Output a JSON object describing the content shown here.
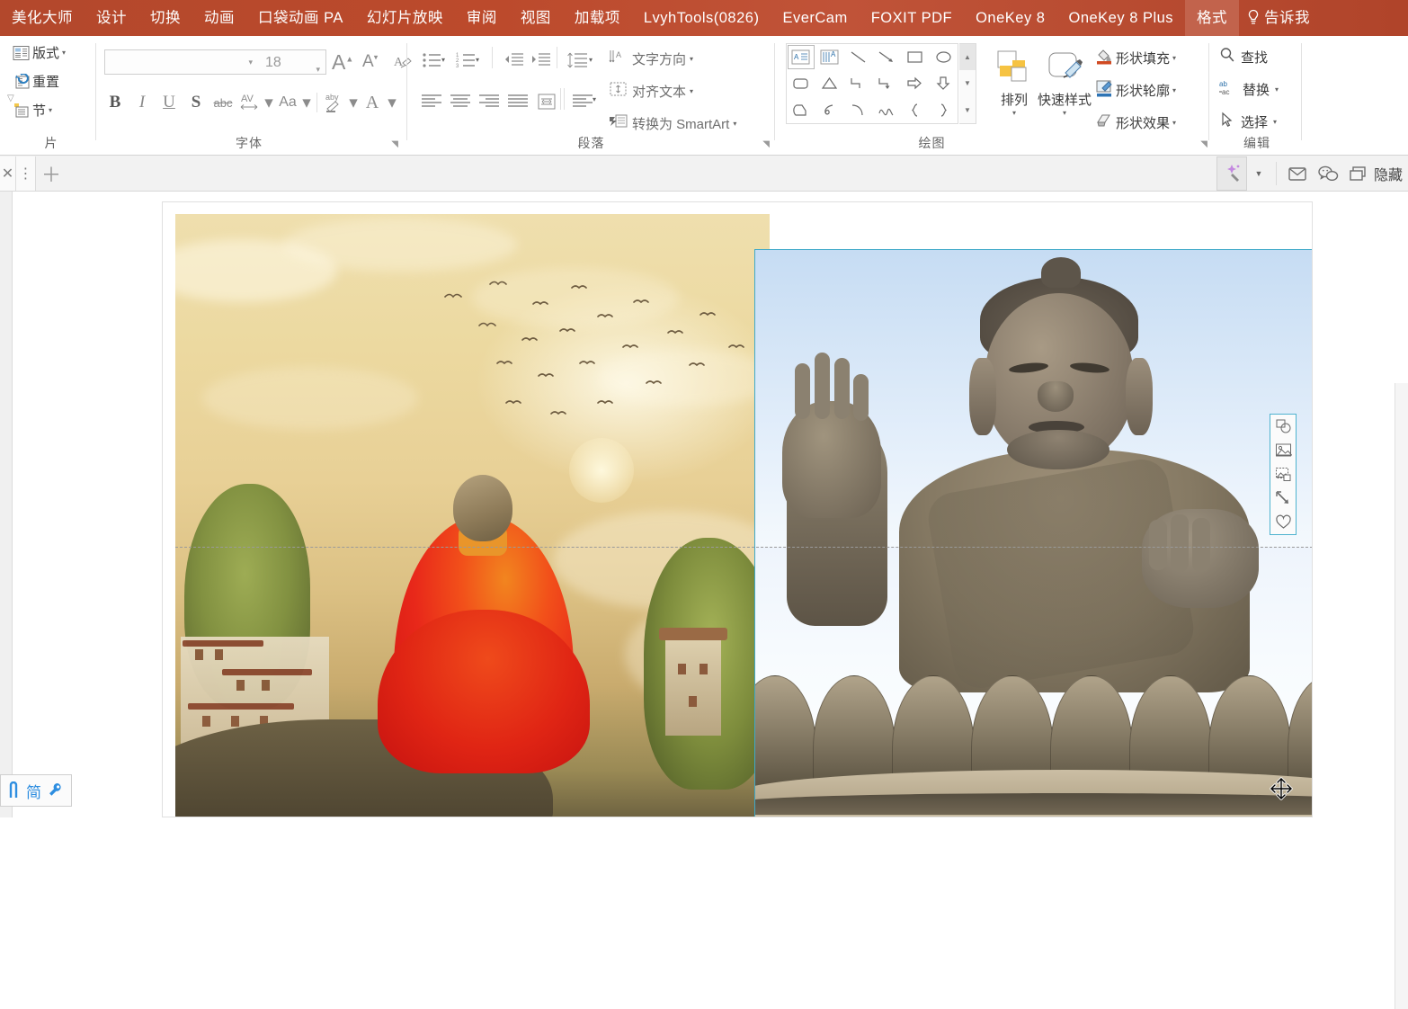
{
  "window": {
    "app": "PowerPoint",
    "accent_color": "#b7472a",
    "selection_color": "#3fa9c9"
  },
  "tabs": [
    {
      "label": "美化大师",
      "active": false
    },
    {
      "label": "设计",
      "active": false
    },
    {
      "label": "切换",
      "active": false
    },
    {
      "label": "动画",
      "active": false
    },
    {
      "label": "口袋动画 PA",
      "active": false
    },
    {
      "label": "幻灯片放映",
      "active": false
    },
    {
      "label": "审阅",
      "active": false
    },
    {
      "label": "视图",
      "active": false
    },
    {
      "label": "加载项",
      "active": false
    },
    {
      "label": "LvyhTools(0826)",
      "active": false
    },
    {
      "label": "EverCam",
      "active": false
    },
    {
      "label": "FOXIT PDF",
      "active": false
    },
    {
      "label": "OneKey 8",
      "active": false
    },
    {
      "label": "OneKey 8 Plus",
      "active": false
    },
    {
      "label": "格式",
      "active": true
    }
  ],
  "tell_me": {
    "label": "告诉我",
    "icon": "lightbulb-icon"
  },
  "ribbon": {
    "slides_group": {
      "label": "片",
      "buttons": [
        {
          "label": "版式",
          "icon": "layout-icon",
          "has_caret": true
        },
        {
          "label": "重置",
          "icon": "reset-icon",
          "has_caret": false
        },
        {
          "label": "节",
          "icon": "section-icon",
          "has_caret": true
        }
      ]
    },
    "font_group": {
      "label": "字体",
      "font_name": {
        "value": "",
        "placeholder": ""
      },
      "font_size": {
        "value": "18"
      },
      "grow_font": "A",
      "shrink_font": "A",
      "clear_format_icon": "clear-formatting-icon",
      "buttons": [
        {
          "label": "B",
          "name": "bold"
        },
        {
          "label": "I",
          "name": "italic"
        },
        {
          "label": "U",
          "name": "underline"
        },
        {
          "label": "S",
          "name": "shadow"
        },
        {
          "label": "abc",
          "name": "strikethrough"
        },
        {
          "label": "AV",
          "name": "character-spacing"
        },
        {
          "label": "Aa",
          "name": "change-case"
        },
        {
          "label": "aby",
          "name": "text-highlight"
        },
        {
          "label": "A",
          "name": "font-color"
        }
      ]
    },
    "paragraph_group": {
      "label": "段落",
      "text_direction": "文字方向",
      "align_text": "对齐文本",
      "convert_smartart": "转换为 SmartArt"
    },
    "drawing_group": {
      "label": "绘图",
      "arrange": "排列",
      "quick_styles": "快速样式",
      "shapes": [
        "textbox-icon",
        "vertical-textbox-icon",
        "line-icon",
        "arrow-icon",
        "rectangle-icon",
        "oval-icon",
        "rounded-rect-icon",
        "triangle-icon",
        "elbow-connector-icon",
        "elbow-arrow-icon",
        "block-arrow-right-icon",
        "block-arrow-down-icon",
        "freeform-icon",
        "scribble-icon",
        "arc-icon",
        "curve-icon",
        "left-brace-icon",
        "right-brace-icon"
      ]
    },
    "shape_styles_group": {
      "rows": [
        {
          "label": "形状填充",
          "icon": "shape-fill-icon",
          "has_caret": true
        },
        {
          "label": "形状轮廓",
          "icon": "shape-outline-icon",
          "has_caret": true
        },
        {
          "label": "形状效果",
          "icon": "shape-effects-icon",
          "has_caret": true
        }
      ]
    },
    "editing_group": {
      "label": "编辑",
      "rows": [
        {
          "label": "查找",
          "icon": "search-icon",
          "has_caret": false
        },
        {
          "label": "替换",
          "icon": "replace-icon",
          "has_caret": true
        },
        {
          "label": "选择",
          "icon": "select-icon",
          "has_caret": true
        }
      ]
    }
  },
  "toolbar2": {
    "left_items": [
      {
        "name": "close-icon",
        "glyph": "✕"
      },
      {
        "name": "more-vertical-icon",
        "glyph": "⋮"
      },
      {
        "name": "add-icon",
        "glyph": "＋"
      }
    ],
    "right_items": [
      {
        "name": "magic-wand-icon"
      },
      {
        "name": "chevron-down-icon"
      },
      {
        "name": "mail-icon"
      },
      {
        "name": "wechat-icon"
      },
      {
        "name": "window-icon"
      },
      {
        "name": "hide-label",
        "label": "隐藏"
      }
    ]
  },
  "canvas": {
    "guide_line": {
      "orientation": "horizontal",
      "style": "dashed"
    },
    "cursor": "move-cursor",
    "pictures": [
      {
        "name": "picture-monk",
        "selected": false,
        "alt": "meditating monk illustration"
      },
      {
        "name": "picture-buddha",
        "selected": true,
        "alt": "Tian Tan Buddha statue photo"
      }
    ]
  },
  "float_toolbar": {
    "items": [
      {
        "name": "crop-shape-icon"
      },
      {
        "name": "picture-icon"
      },
      {
        "name": "insert-picture-icon"
      },
      {
        "name": "resize-arrow-icon"
      },
      {
        "name": "favorite-heart-icon"
      }
    ]
  },
  "ime": {
    "items": [
      {
        "name": "ime-pen-icon"
      },
      {
        "name": "ime-simplified-label",
        "label": "简"
      },
      {
        "name": "ime-settings-icon"
      }
    ]
  }
}
